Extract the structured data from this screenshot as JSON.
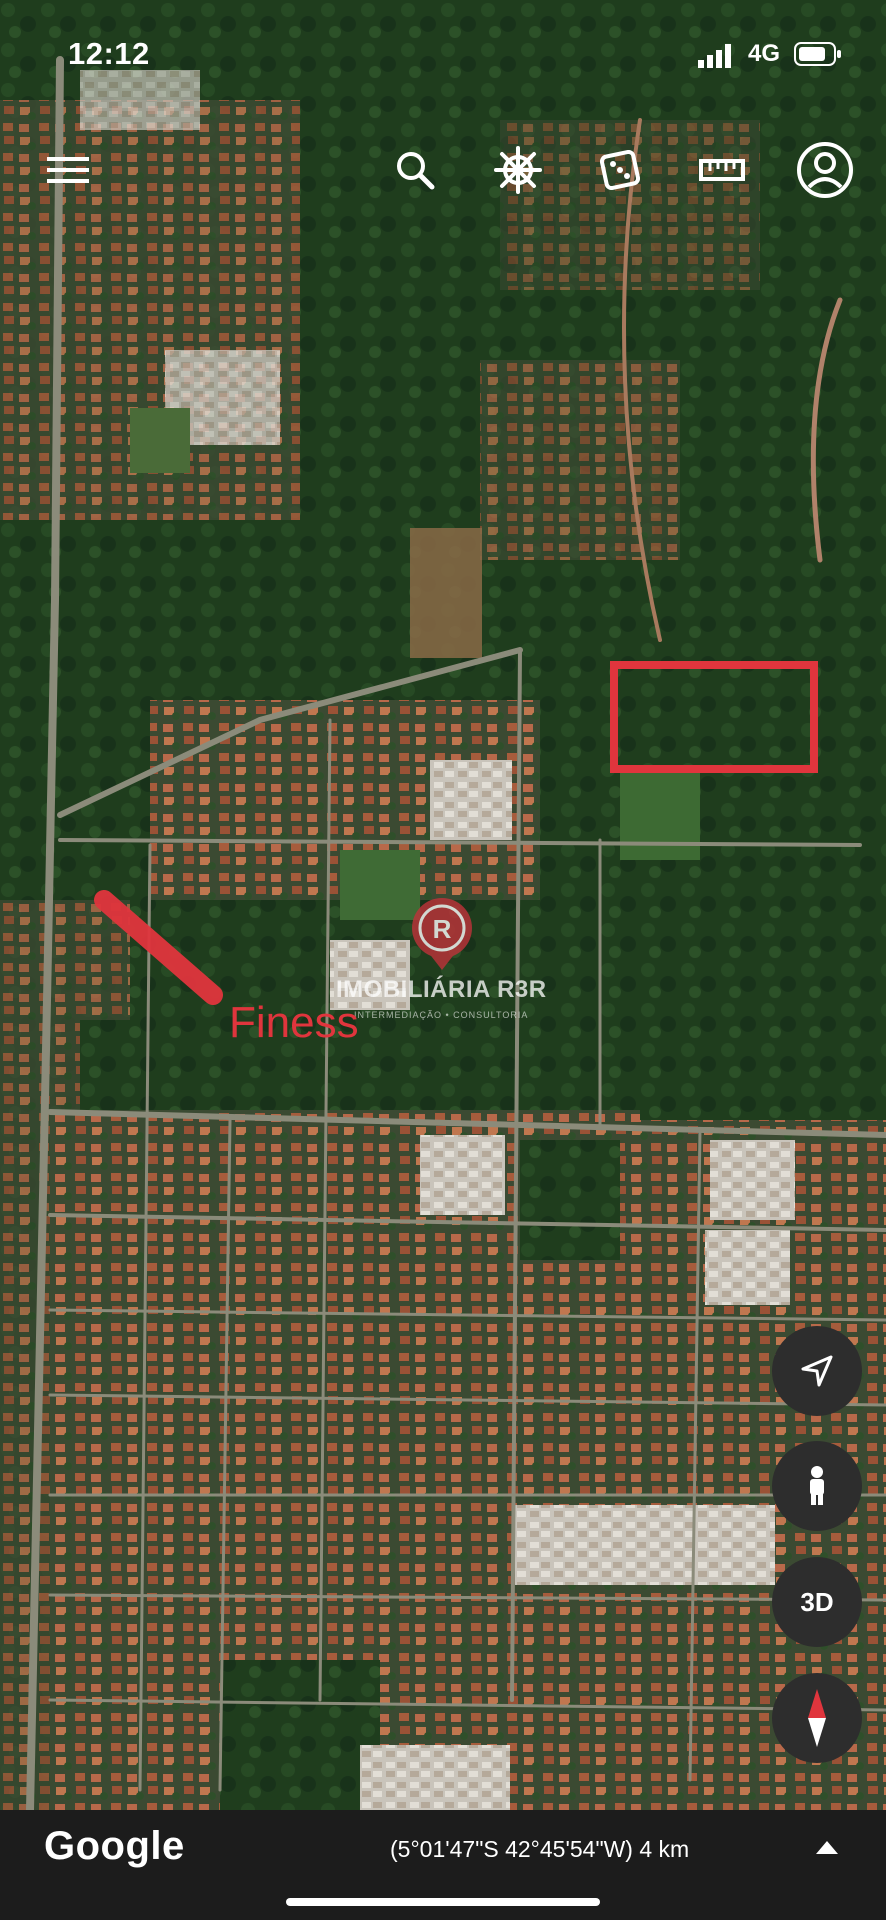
{
  "status_bar": {
    "time": "12:12",
    "network": "4G"
  },
  "toolbar": {
    "items": [
      "menu-icon",
      "search-icon",
      "voyager-wheel-icon",
      "feeling-lucky-dice-icon",
      "measure-ruler-icon",
      "account-icon"
    ]
  },
  "map": {
    "annotation_label": "Finess",
    "annotation_color": "#e0353d",
    "highlight_color": "#e0353d",
    "watermark_text": "IMOBILIÁRIA R3R",
    "watermark_subtext": "INTERMEDIAÇÃO • CONSULTORIA"
  },
  "controls": {
    "locate": "navigation-arrow-icon",
    "street_view": "pegman-icon",
    "mode_3d": "3D",
    "compass": "compass-icon"
  },
  "bottom_bar": {
    "brand": "Google",
    "coordinates": "(5°01'47\"S 42°45'54\"W) 4 km"
  }
}
